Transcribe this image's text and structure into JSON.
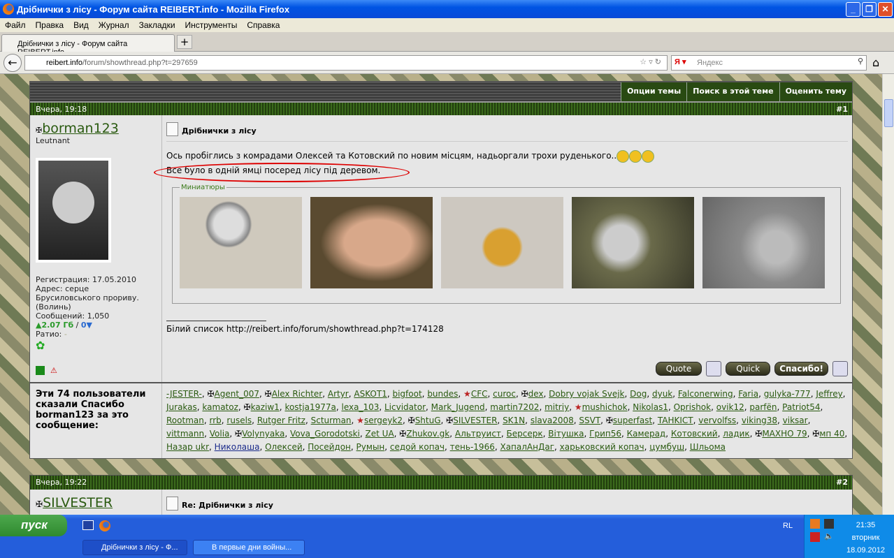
{
  "window": {
    "title": "Дрібнички з лісу - Форум сайта REIBERT.info - Mozilla Firefox"
  },
  "menu": [
    "Файл",
    "Правка",
    "Вид",
    "Журнал",
    "Закладки",
    "Инструменты",
    "Справка"
  ],
  "tab": {
    "label": "Дрібнички з лісу - Форум сайта REIBERT.info",
    "new": "+"
  },
  "nav": {
    "url_domain": "reibert.info",
    "url_path": "/forum/showthread.php?t=297659",
    "search_placeholder": "Яндекс"
  },
  "thread_options": [
    "Опции темы",
    "Поиск в этой теме",
    "Оценить тему"
  ],
  "post1": {
    "date": "Вчера, 19:18",
    "number": "#1",
    "user": {
      "name": "borman123",
      "rank": "Leutnant",
      "registration": "Регистрация: 17.05.2010",
      "address": "Адрес: серце Брусиловського прориву. (Волинь)",
      "posts": "Сообщений: 1,050",
      "upload": "▲2.07 Гб",
      "separator": " / ",
      "download": "0▼",
      "ratio_label": "Ратио: ",
      "ratio": "-"
    },
    "title": "Дрібнички з лісу",
    "line1": "Ось пробіглись з комрадами Олексей та Котовский по новим місцям, надьоргали трохи руденького..",
    "line2": "Все було в одній ямці посеред лісу під деревом.",
    "thumbnails_label": "Миниатюры",
    "signature": "Білий список http://reibert.info/forum/showthread.php?t=174128",
    "buttons": {
      "quote": "Quote",
      "quick": "Quick",
      "thanks": "Спасибо!"
    }
  },
  "thanks": {
    "label": "Эти 74 пользователи сказали Спасибо borman123 за это сообщение:",
    "users": [
      [
        "-JESTER-",
        ""
      ],
      [
        "Agent_007",
        "cross"
      ],
      [
        "Alex Richter",
        "cross"
      ],
      [
        "Artyr",
        ""
      ],
      [
        "ASKOT1",
        ""
      ],
      [
        "bigfoot",
        ""
      ],
      [
        "bundes",
        ""
      ],
      [
        "CFC",
        "star"
      ],
      [
        "curoc",
        ""
      ],
      [
        "dex",
        "cross"
      ],
      [
        "Dobry vojak Svejk",
        ""
      ],
      [
        "Dog",
        ""
      ],
      [
        "dyuk",
        ""
      ],
      [
        "Falconerwing",
        ""
      ],
      [
        "Faria",
        ""
      ],
      [
        "gulyka-777",
        ""
      ],
      [
        "Jeffrey",
        ""
      ],
      [
        "Jurakas",
        ""
      ],
      [
        "kamatoz",
        ""
      ],
      [
        "kaziw1",
        "cross"
      ],
      [
        "kostja1977a",
        ""
      ],
      [
        "lexa_103",
        ""
      ],
      [
        "Licvidator",
        ""
      ],
      [
        "Mark_Jugend",
        ""
      ],
      [
        "martin7202",
        ""
      ],
      [
        "mitriy",
        ""
      ],
      [
        "mushichok",
        "star"
      ],
      [
        "Nikolas1",
        ""
      ],
      [
        "Oprishok",
        ""
      ],
      [
        "ovik12",
        ""
      ],
      [
        "parfën",
        ""
      ],
      [
        "Patriot54",
        ""
      ],
      [
        "Rootman",
        ""
      ],
      [
        "rrb",
        ""
      ],
      [
        "rusels",
        ""
      ],
      [
        "Rutger Fritz",
        ""
      ],
      [
        "Scturman",
        ""
      ],
      [
        "sergeyk2",
        "star"
      ],
      [
        "ShtuG",
        "cross"
      ],
      [
        "SILVESTER",
        "cross"
      ],
      [
        "SK1N",
        ""
      ],
      [
        "slava2008",
        ""
      ],
      [
        "SSVT",
        ""
      ],
      [
        "superfast",
        "cross"
      ],
      [
        "TAHKICT",
        ""
      ],
      [
        "vervolfss",
        ""
      ],
      [
        "viking38",
        ""
      ],
      [
        "viksar",
        ""
      ],
      [
        "vittmann",
        ""
      ],
      [
        "Volia",
        ""
      ],
      [
        "Volynyaka",
        "cross"
      ],
      [
        "Vova_Gorodotski",
        ""
      ],
      [
        "Zet UA",
        ""
      ],
      [
        "Zhukov.gk",
        "cross"
      ],
      [
        "Альтруист",
        ""
      ],
      [
        "Берсерк",
        ""
      ],
      [
        "Вітушка",
        ""
      ],
      [
        "Грип56",
        ""
      ],
      [
        "Камерад",
        ""
      ],
      [
        "Котовский",
        ""
      ],
      [
        "ладик",
        ""
      ],
      [
        "МАХНО 79",
        "cross"
      ],
      [
        "мп 40",
        "cross"
      ],
      [
        "Назар ukr",
        ""
      ],
      [
        "Николаша",
        "blue"
      ],
      [
        "Олексей",
        ""
      ],
      [
        "Посейдон",
        ""
      ],
      [
        "Румын",
        ""
      ],
      [
        "седой копач",
        ""
      ],
      [
        "тень-1966",
        ""
      ],
      [
        "ХапалАнДаг",
        ""
      ],
      [
        "харьковский копач",
        ""
      ],
      [
        "цумбуш",
        ""
      ],
      [
        "Шльома",
        ""
      ]
    ]
  },
  "post2": {
    "date": "Вчера, 19:22",
    "number": "#2",
    "user": "SILVESTER",
    "title": "Re: Дрібнички з лісу"
  },
  "taskbar": {
    "start": "пуск",
    "tasks": [
      "Дрібнички з лісу - Ф...",
      "В первые дни войны..."
    ],
    "lang": "RL",
    "time": "21:35",
    "day": "вторник",
    "date": "18.09.2012"
  }
}
